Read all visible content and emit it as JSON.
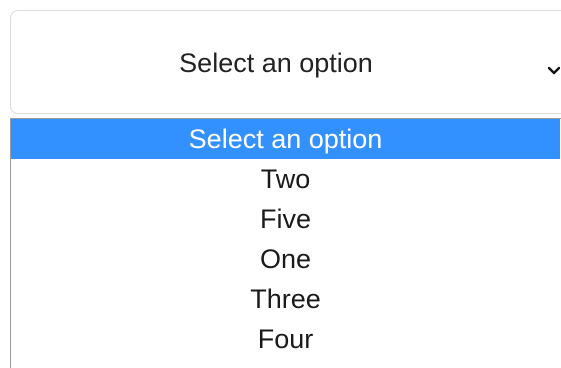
{
  "select": {
    "value": "Select an option",
    "icon": "chevron-down-icon"
  },
  "dropdown": {
    "options": [
      {
        "label": "Select an option",
        "selected": true
      },
      {
        "label": "Two",
        "selected": false
      },
      {
        "label": "Five",
        "selected": false
      },
      {
        "label": "One",
        "selected": false
      },
      {
        "label": "Three",
        "selected": false
      },
      {
        "label": "Four",
        "selected": false
      }
    ]
  },
  "colors": {
    "highlight": "#3390ff",
    "highlight_text": "#ffffff",
    "text": "#1a1a1a",
    "border": "#dcdcdc"
  }
}
